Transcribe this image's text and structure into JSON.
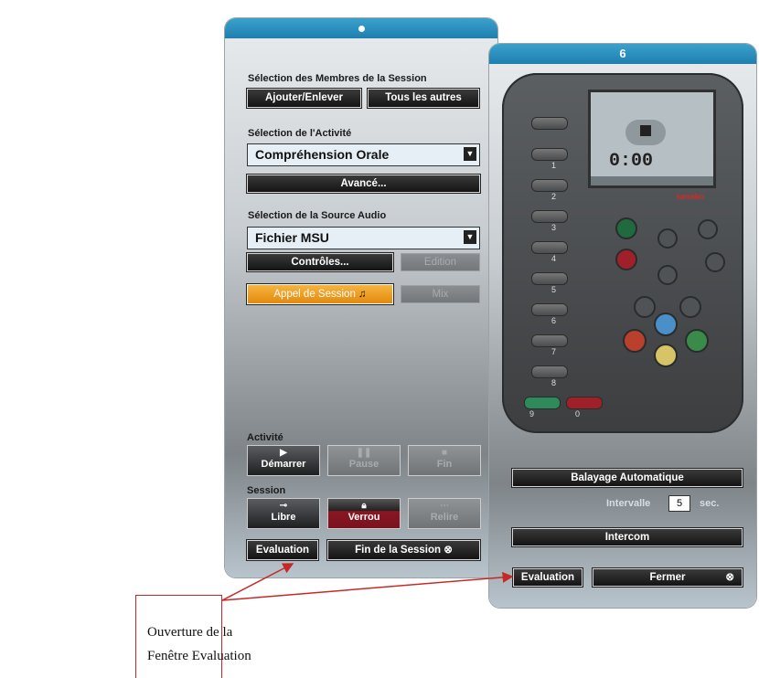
{
  "left_panel": {
    "members_heading": "Sélection des Membres de la Session",
    "add_remove": "Ajouter/Enlever",
    "all_others": "Tous les autres",
    "activity_heading": "Sélection de l'Activité",
    "activity_value": "Compréhension Orale",
    "advanced": "Avancé...",
    "audio_heading": "Sélection de la Source Audio",
    "audio_value": "Fichier MSU",
    "controls": "Contrôles...",
    "edition": "Edition",
    "session_call": "Appel de Session",
    "mix": "Mix",
    "activity_label": "Activité",
    "start": "Démarrer",
    "pause": "Pause",
    "end": "Fin",
    "session_label": "Session",
    "free": "Libre",
    "lock": "Verrou",
    "reread": "Relire",
    "evaluation": "Evaluation",
    "end_session": "Fin de la Session"
  },
  "right_panel": {
    "title": "6",
    "brand": "sanako",
    "lcd_time": "0:00",
    "slot_numbers": [
      "1",
      "2",
      "3",
      "4",
      "5",
      "6",
      "7",
      "8"
    ],
    "bottom_labels": [
      "9",
      "0"
    ],
    "auto_scan": "Balayage Automatique",
    "interval_label": "Intervalle",
    "interval_value": "5",
    "interval_unit": "sec.",
    "intercom": "Intercom",
    "evaluation": "Evaluation",
    "close": "Fermer"
  },
  "callout": {
    "line1": "Ouverture de la",
    "line2": "Fenêtre Evaluation"
  },
  "colors": {
    "accent": "#2a8fbf",
    "orange": "#f0a020",
    "lock_red": "#8b1622",
    "callout_red": "#c62828"
  }
}
